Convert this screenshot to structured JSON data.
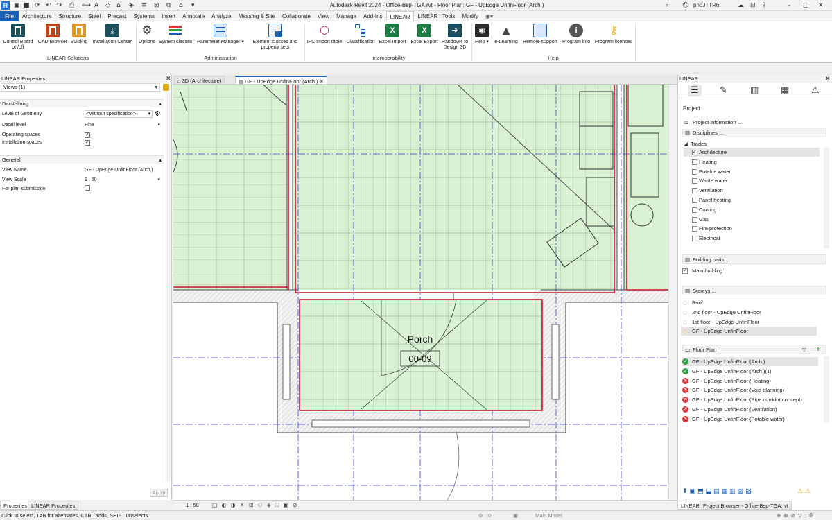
{
  "app": {
    "window_title": "Autodesk Revit 2024 - Office-Bsp-TGA.rvt - Floor Plan: GF - UpEdge UnfinFloor (Arch.)",
    "user": "phoJTTR6",
    "share_label": "Share"
  },
  "tabs": [
    "File",
    "Architecture",
    "Structure",
    "Steel",
    "Precast",
    "Systems",
    "Insert",
    "Annotate",
    "Analyze",
    "Massing & Site",
    "Collaborate",
    "View",
    "Manage",
    "Add-Ins",
    "LINEAR",
    "LINEAR | Tools",
    "Modify"
  ],
  "ribbon": {
    "panels": [
      "LINEAR Solutions",
      "Administration",
      "Interoperability",
      "Help"
    ],
    "solutions": [
      "Control Board on/off",
      "CAD Browser",
      "Building",
      "Installation Center"
    ],
    "administration": [
      "Options",
      "System classes",
      "Parameter Manager",
      "Element classes and property sets"
    ],
    "interop": [
      "IFC Import table",
      "Classification",
      "Excel Import",
      "Excel Export",
      "Handover to Design 3D"
    ],
    "help": [
      "Help",
      "e-Learning",
      "Remote support",
      "Program info",
      "Program licenses"
    ]
  },
  "props": {
    "title": "LINEAR Properties",
    "selector": "Views (1)",
    "sect_display": "Darstellung",
    "log_k": "Level of Geometry",
    "log_v": "<without specification>",
    "detail_k": "Detail level",
    "detail_v": "Fine",
    "op_k": "Operating spaces",
    "inst_k": "Installation spaces",
    "sect_general": "General",
    "vname_k": "View Name",
    "vname_v": "GF - UpEdge UnfinFloor (Arch.)",
    "vscale_k": "View Scale",
    "vscale_v": "1 : 50",
    "plan_k": "For plan submission",
    "apply": "Apply"
  },
  "viewtabs": [
    "3D (Architecture)",
    "GF - UpEdge UnfinFloor (Arch.)"
  ],
  "canvas": {
    "room_name": "Porch",
    "room_number": "00-09"
  },
  "viewbar": {
    "scale": "1 : 50",
    "model": "Main Model"
  },
  "linear": {
    "title": "LINEAR",
    "project": "Project",
    "project_info": "Project information ...",
    "disciplines": "Disciplines ...",
    "trades_head": "Trades",
    "trades": [
      "Architecture",
      "Heating",
      "Potable water",
      "Waste water",
      "Ventilation",
      "Panel heating",
      "Cooling",
      "Gas",
      "Fire protection",
      "Electrical"
    ],
    "building_parts": "Building parts ...",
    "main_building": "Main building",
    "storeys": "Storeys ...",
    "storey_list": [
      "Roof",
      "2nd floor - UpEdge UnfinFloor",
      "1st floor - UpEdge UnfinFloor",
      "GF - UpEdge UnfinFloor"
    ],
    "floorplan_head": "Floor Plan",
    "floorplans": [
      {
        "name": "GF - UpEdge UnfinFloor (Arch.)",
        "status": "ok"
      },
      {
        "name": "GF - UpEdge UnfinFloor (Arch.)(1)",
        "status": "ok"
      },
      {
        "name": "GF - UpEdge UnfinFloor (Heating)",
        "status": "error"
      },
      {
        "name": "GF - UpEdge UnfinFloor (Void planning)",
        "status": "error"
      },
      {
        "name": "GF - UpEdge UnfinFloor (Pipe corridor concept)",
        "status": "error"
      },
      {
        "name": "GF - UpEdge UnfinFloor (Ventilation)",
        "status": "error"
      },
      {
        "name": "GF - UpEdge UnfinFloor (Potable water)",
        "status": "error"
      }
    ]
  },
  "bottom_tabs_left": [
    "Properties",
    "LINEAR Properties"
  ],
  "bottom_tabs_right": [
    "LINEAR",
    "Project Browser - Office-Bsp-TGA.rvt"
  ],
  "status_text": "Click to select, TAB for alternates, CTRL adds, SHIFT unselects.",
  "status_zero": ":0",
  "colors": {
    "floor_fill": "#d9f2d3",
    "wall_red": "#c8102e",
    "grid_blue": "#3b3bd1",
    "accent": "#1a5fb4"
  }
}
